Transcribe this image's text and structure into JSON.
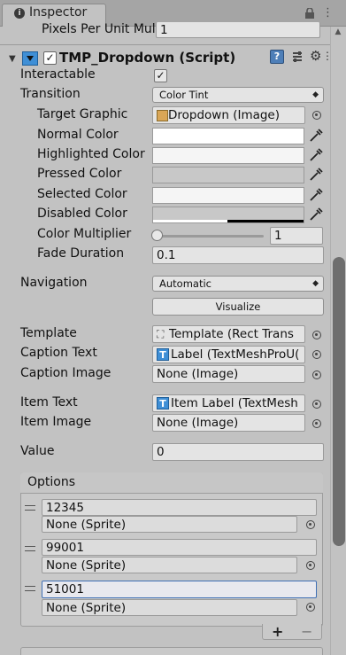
{
  "tab": {
    "title": "Inspector"
  },
  "prev_component": {
    "label": "Pixels Per Unit Mult",
    "value": "1"
  },
  "component": {
    "title": "TMP_Dropdown (Script)",
    "enabled": true
  },
  "props": {
    "interactable": {
      "label": "Interactable",
      "checked": true
    },
    "transition": {
      "label": "Transition",
      "value": "Color Tint"
    },
    "target_graphic": {
      "label": "Target Graphic",
      "value": "Dropdown (Image)"
    },
    "normal_color": {
      "label": "Normal Color",
      "color": "#ffffff"
    },
    "highlighted_color": {
      "label": "Highlighted Color",
      "color": "#f5f5f5"
    },
    "pressed_color": {
      "label": "Pressed Color",
      "color": "#c8c8c8"
    },
    "selected_color": {
      "label": "Selected Color",
      "color": "#f5f5f5"
    },
    "disabled_color": {
      "label": "Disabled Color",
      "color": "#c8c8c8"
    },
    "color_multiplier": {
      "label": "Color Multiplier",
      "value": "1",
      "slider_level": 0.0
    },
    "fade_duration": {
      "label": "Fade Duration",
      "value": "0.1"
    },
    "navigation": {
      "label": "Navigation",
      "value": "Automatic"
    },
    "visualize": {
      "label": "Visualize"
    },
    "template": {
      "label": "Template",
      "value": "Template (Rect Trans"
    },
    "caption_text": {
      "label": "Caption Text",
      "value": "Label (TextMeshProU("
    },
    "caption_image": {
      "label": "Caption Image",
      "value": "None (Image)"
    },
    "item_text": {
      "label": "Item Text",
      "value": "Item Label (TextMesh"
    },
    "item_image": {
      "label": "Item Image",
      "value": "None (Image)"
    },
    "value": {
      "label": "Value",
      "value": "0"
    }
  },
  "options": {
    "title": "Options",
    "items": [
      {
        "text": "12345",
        "image": "None (Sprite)"
      },
      {
        "text": "99001",
        "image": "None (Sprite)"
      },
      {
        "text": "51001",
        "image": "None (Sprite)"
      }
    ],
    "add_label": "+",
    "remove_label": "−"
  },
  "colors": {
    "panel_bg": "#c2c2c2",
    "accent_blue": "#3f8fd6"
  }
}
